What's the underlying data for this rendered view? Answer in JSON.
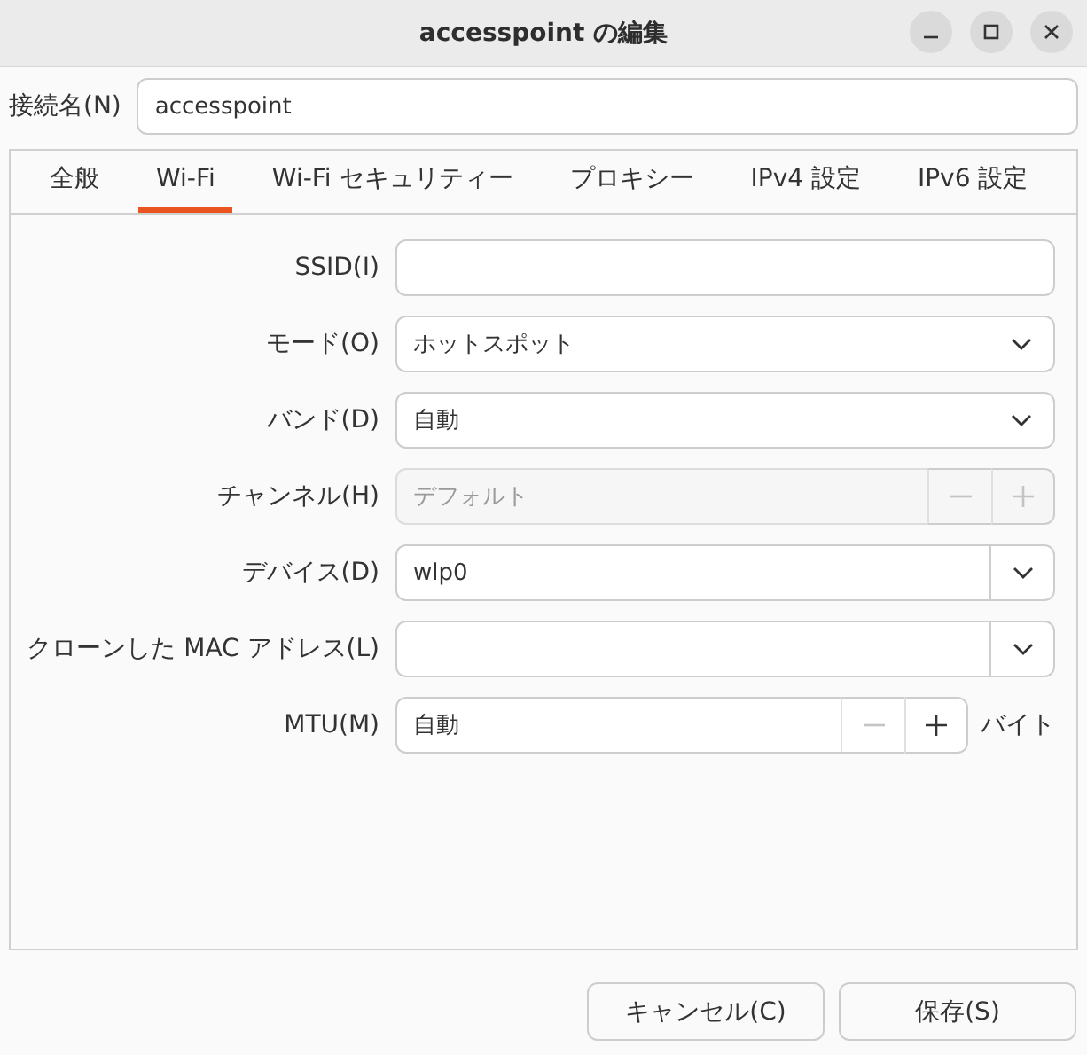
{
  "window": {
    "title": "accesspoint の編集"
  },
  "connection_name": {
    "label": "接続名(N)",
    "value": "accesspoint"
  },
  "tabs": [
    {
      "label": "全般",
      "selected": false
    },
    {
      "label": "Wi-Fi",
      "selected": true
    },
    {
      "label": "Wi-Fi セキュリティー",
      "selected": false
    },
    {
      "label": "プロキシー",
      "selected": false
    },
    {
      "label": "IPv4 設定",
      "selected": false
    },
    {
      "label": "IPv6 設定",
      "selected": false
    }
  ],
  "fields": [
    {
      "kind": "entry",
      "label": "SSID(I)"
    },
    {
      "kind": "combo",
      "label": "モード(O)",
      "value": "ホットスポット"
    },
    {
      "kind": "combo",
      "label": "バンド(D)",
      "value": "自動"
    },
    {
      "kind": "spin",
      "label": "チャンネル(H)",
      "placeholder": "デフォルト",
      "disabled": true,
      "minus_disabled": true,
      "plus_disabled": true
    },
    {
      "kind": "combo_entry",
      "label": "デバイス(D)",
      "value": "wlp0"
    },
    {
      "kind": "combo_entry",
      "label": "クローンした MAC アドレス(L)"
    },
    {
      "kind": "spin",
      "label": "MTU(M)",
      "value": "自動",
      "disabled": false,
      "minus_disabled": true,
      "plus_disabled": false,
      "unit": "バイト"
    }
  ],
  "buttons": [
    "キャンセル(C)",
    "保存(S)"
  ]
}
